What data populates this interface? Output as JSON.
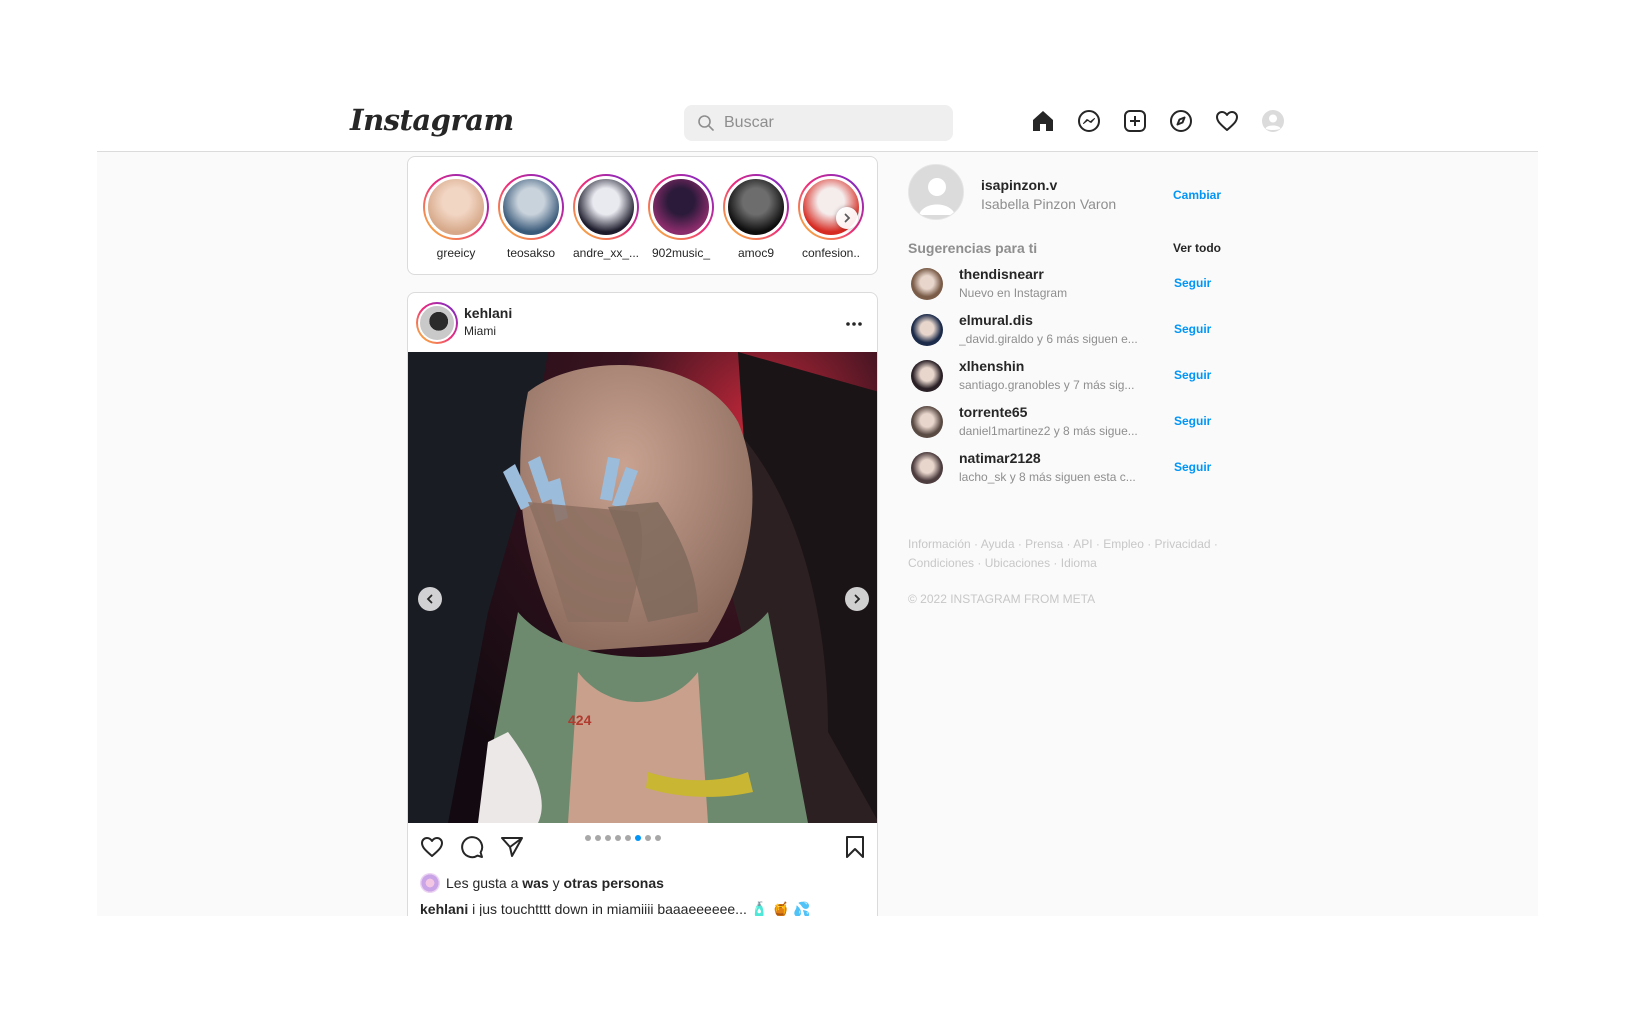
{
  "header": {
    "logo": "Instagram",
    "search_placeholder": "Buscar",
    "nav_icons": [
      "home-icon",
      "messenger-icon",
      "new-post-icon",
      "explore-icon",
      "activity-heart-icon",
      "profile-avatar-icon"
    ]
  },
  "stories": [
    {
      "username": "greeicy",
      "colors": [
        "#d7a98a",
        "#f2d6c4"
      ]
    },
    {
      "username": "teosakso",
      "colors": [
        "#3a5a7a",
        "#c9d3dc"
      ]
    },
    {
      "username": "andre_xx_...",
      "colors": [
        "#1c1c2c",
        "#e9e9f0"
      ]
    },
    {
      "username": "902music_",
      "colors": [
        "#8a2c6b",
        "#2b1a3a"
      ]
    },
    {
      "username": "amoc9",
      "colors": [
        "#0d0d0d",
        "#6d6d6d"
      ]
    },
    {
      "username": "confesion..",
      "colors": [
        "#d62b22",
        "#f5ecec"
      ]
    }
  ],
  "post": {
    "username": "kehlani",
    "location": "Miami",
    "carousel_count": 8,
    "carousel_active_index": 5,
    "likes_text_prefix": "Les gusta a",
    "likes_user": "was",
    "likes_conjunction": "y",
    "likes_others": "otras personas",
    "caption_user": "kehlani",
    "caption_text": "i jus touchtttt down in miamiiii baaaeeeeee... 🧴 🍯 💦"
  },
  "sidebar": {
    "me_username": "isapinzon.v",
    "me_fullname": "Isabella Pinzon Varon",
    "switch_label": "Cambiar",
    "suggestions_title": "Sugerencias para ti",
    "see_all_label": "Ver todo",
    "follow_label": "Seguir",
    "suggestions": [
      {
        "username": "thendisnearr",
        "subtitle": "Nuevo en Instagram",
        "color": "#7a5c48"
      },
      {
        "username": "elmural.dis",
        "subtitle": "_david.giraldo y 6 más siguen e...",
        "color": "#1c2b4a"
      },
      {
        "username": "xlhenshin",
        "subtitle": "santiago.granobles y 7 más sig...",
        "color": "#2a2026"
      },
      {
        "username": "torrente65",
        "subtitle": "daniel1martinez2 y 8 más sigue...",
        "color": "#5a4a44"
      },
      {
        "username": "natimar2128",
        "subtitle": "lacho_sk y 8 más siguen esta c...",
        "color": "#4d3d3f"
      }
    ],
    "footer_links": "Información · Ayuda · Prensa · API · Empleo · Privacidad · Condiciones · Ubicaciones · Idioma",
    "copyright": "© 2022 INSTAGRAM FROM META"
  }
}
